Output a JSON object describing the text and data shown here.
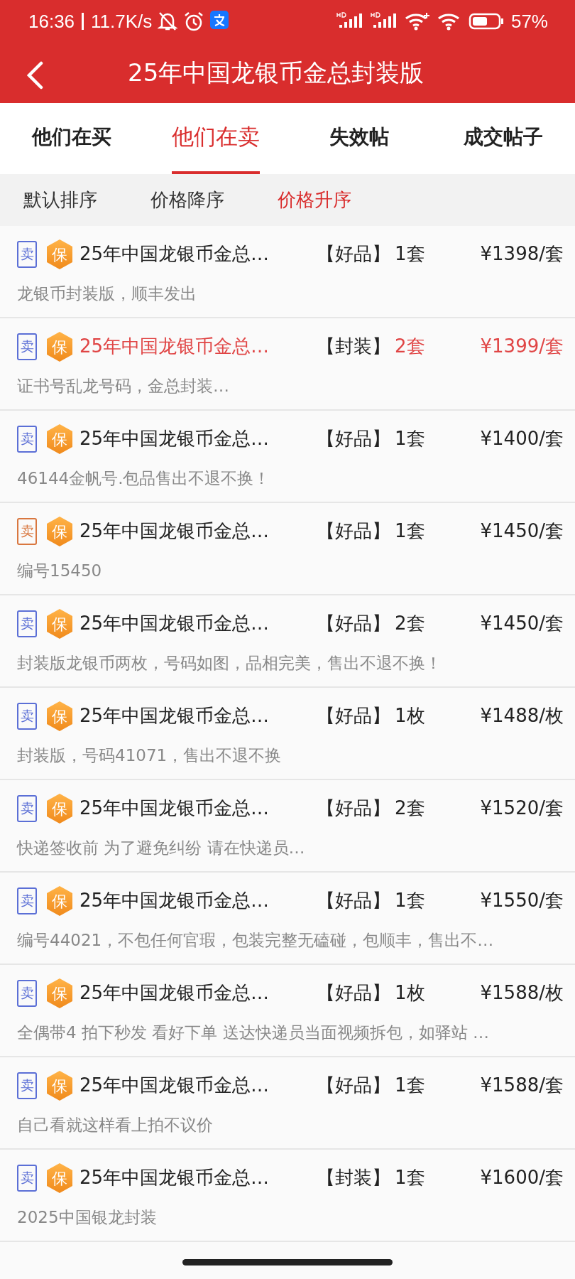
{
  "status_bar": {
    "time": "16:36",
    "speed": "11.7K/s",
    "battery": "57%"
  },
  "header": {
    "title": "25年中国龙银币金总封装版"
  },
  "tabs": [
    {
      "label": "他们在买",
      "selected": false
    },
    {
      "label": "他们在卖",
      "selected": true
    },
    {
      "label": "失效帖",
      "selected": false
    },
    {
      "label": "成交帖子",
      "selected": false
    }
  ],
  "sort_options": [
    {
      "label": "默认排序",
      "selected": false
    },
    {
      "label": "价格降序",
      "selected": false
    },
    {
      "label": "价格升序",
      "selected": true
    }
  ],
  "listings": [
    {
      "tag": "卖",
      "color": "#5b6fd6",
      "badge": "保",
      "title": "25年中国龙银币金总…",
      "grade": "【好品】",
      "quantity": "1套",
      "price": "¥1398/套",
      "note": "龙银币封装版，顺丰发出",
      "highlighted": false
    },
    {
      "tag": "卖",
      "color": "#5b6fd6",
      "badge": "保",
      "title": "25年中国龙银币金总…",
      "grade": "【封装】",
      "quantity": "2套",
      "price": "¥1399/套",
      "note": "证书号乱龙号码，金总封装…",
      "highlighted": true
    },
    {
      "tag": "卖",
      "color": "#5b6fd6",
      "badge": "保",
      "title": "25年中国龙银币金总…",
      "grade": "【好品】",
      "quantity": "1套",
      "price": "¥1400/套",
      "note": "46144金帆号.包品售出不退不换！",
      "highlighted": false
    },
    {
      "tag": "卖",
      "color": "#d9773f",
      "badge": "保",
      "title": "25年中国龙银币金总…",
      "grade": "【好品】",
      "quantity": "1套",
      "price": "¥1450/套",
      "note": "编号15450",
      "highlighted": false
    },
    {
      "tag": "卖",
      "color": "#5b6fd6",
      "badge": "保",
      "title": "25年中国龙银币金总…",
      "grade": "【好品】",
      "quantity": "2套",
      "price": "¥1450/套",
      "note": "封装版龙银币两枚，号码如图，品相完美，售出不退不换！",
      "highlighted": false
    },
    {
      "tag": "卖",
      "color": "#5b6fd6",
      "badge": "保",
      "title": "25年中国龙银币金总…",
      "grade": "【好品】",
      "quantity": "1枚",
      "price": "¥1488/枚",
      "note": "封装版，号码41071，售出不退不换",
      "highlighted": false
    },
    {
      "tag": "卖",
      "color": "#5b6fd6",
      "badge": "保",
      "title": "25年中国龙银币金总…",
      "grade": "【好品】",
      "quantity": "2套",
      "price": "¥1520/套",
      "note": "快递签收前 为了避免纠纷 请在快递员…",
      "highlighted": false
    },
    {
      "tag": "卖",
      "color": "#5b6fd6",
      "badge": "保",
      "title": "25年中国龙银币金总…",
      "grade": "【好品】",
      "quantity": "1套",
      "price": "¥1550/套",
      "note": "编号44021，不包任何官瑕，包装完整无磕碰，包顺丰，售出不…",
      "highlighted": false
    },
    {
      "tag": "卖",
      "color": "#5b6fd6",
      "badge": "保",
      "title": "25年中国龙银币金总…",
      "grade": "【好品】",
      "quantity": "1枚",
      "price": "¥1588/枚",
      "note": "全偶带4 拍下秒发 看好下单 送达快递员当面视频拆包，如驿站 …",
      "highlighted": false
    },
    {
      "tag": "卖",
      "color": "#5b6fd6",
      "badge": "保",
      "title": "25年中国龙银币金总…",
      "grade": "【好品】",
      "quantity": "1套",
      "price": "¥1588/套",
      "note": "自己看就这样看上拍不议价",
      "highlighted": false
    },
    {
      "tag": "卖",
      "color": "#5b6fd6",
      "badge": "保",
      "title": "25年中国龙银币金总…",
      "grade": "【封装】",
      "quantity": "1套",
      "price": "¥1600/套",
      "note": "2025中国银龙封装",
      "highlighted": false
    }
  ]
}
